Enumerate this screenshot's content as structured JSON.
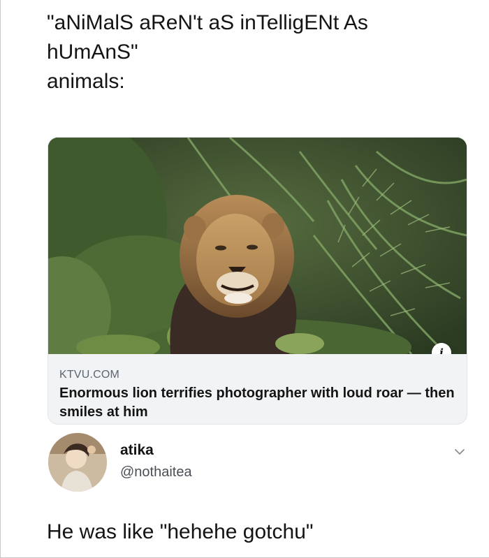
{
  "tweet": {
    "text_lines": [
      "\"aNiMalS aReN't aS inTelligENt As",
      "hUmAnS\"",
      "animals:"
    ]
  },
  "link_card": {
    "domain": "KTVU.COM",
    "title": "Enormous lion terrifies photographer with loud roar — then smiles at him",
    "image_icon": "lion-in-palm-bushes",
    "info_icon": "info-icon"
  },
  "reply": {
    "name": "atika",
    "handle": "@nothaitea",
    "text": "He was like \"hehehe gotchu\"",
    "avatar_icon": "avatar",
    "menu_icon": "chevron-down-icon"
  },
  "colors": {
    "text": "#141414",
    "secondary_text": "#5b6670",
    "card_bg": "#f1f3f5"
  }
}
